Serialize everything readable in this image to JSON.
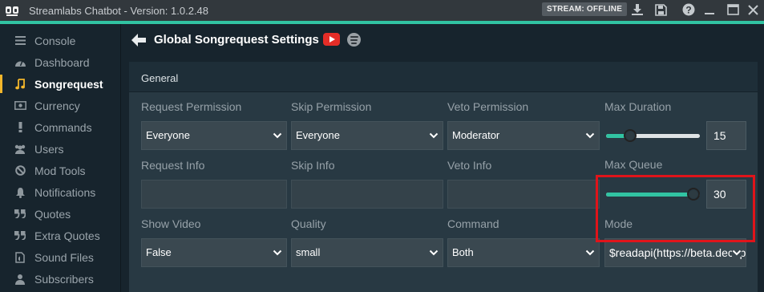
{
  "window": {
    "title": "Streamlabs Chatbot - Version: 1.0.2.48",
    "stream_status": "STREAM: OFFLINE",
    "accent_color": "#31c3a2"
  },
  "titlebar_icons": [
    "download-icon",
    "save-icon",
    "help-icon",
    "minimize-icon",
    "maximize-icon",
    "close-icon"
  ],
  "sidebar": {
    "items": [
      {
        "label": "Console",
        "icon": "console-icon"
      },
      {
        "label": "Dashboard",
        "icon": "dashboard-icon"
      },
      {
        "label": "Songrequest",
        "icon": "music-note-icon",
        "active": true
      },
      {
        "label": "Currency",
        "icon": "currency-icon"
      },
      {
        "label": "Commands",
        "icon": "exclamation-icon"
      },
      {
        "label": "Users",
        "icon": "users-icon"
      },
      {
        "label": "Mod Tools",
        "icon": "ban-icon"
      },
      {
        "label": "Notifications",
        "icon": "bell-icon"
      },
      {
        "label": "Quotes",
        "icon": "quote-icon"
      },
      {
        "label": "Extra Quotes",
        "icon": "quote-icon"
      },
      {
        "label": "Sound Files",
        "icon": "file-audio-icon"
      },
      {
        "label": "Subscribers",
        "icon": "subscriber-icon"
      }
    ]
  },
  "page": {
    "title": "Global Songrequest Settings",
    "section": "General"
  },
  "fields": {
    "request_permission": {
      "label": "Request Permission",
      "value": "Everyone"
    },
    "skip_permission": {
      "label": "Skip Permission",
      "value": "Everyone"
    },
    "veto_permission": {
      "label": "Veto Permission",
      "value": "Moderator"
    },
    "max_duration": {
      "label": "Max Duration",
      "value": "15",
      "slider_fraction": 0.26
    },
    "request_info": {
      "label": "Request Info",
      "value": ""
    },
    "skip_info": {
      "label": "Skip Info",
      "value": ""
    },
    "veto_info": {
      "label": "Veto Info",
      "value": ""
    },
    "max_queue": {
      "label": "Max Queue",
      "value": "30",
      "slider_fraction": 0.98
    },
    "show_video": {
      "label": "Show Video",
      "value": "False"
    },
    "quality": {
      "label": "Quality",
      "value": "small"
    },
    "command": {
      "label": "Command",
      "value": "Both"
    },
    "mode": {
      "label": "Mode",
      "value": "$readapi(https://beta.decapi"
    }
  }
}
